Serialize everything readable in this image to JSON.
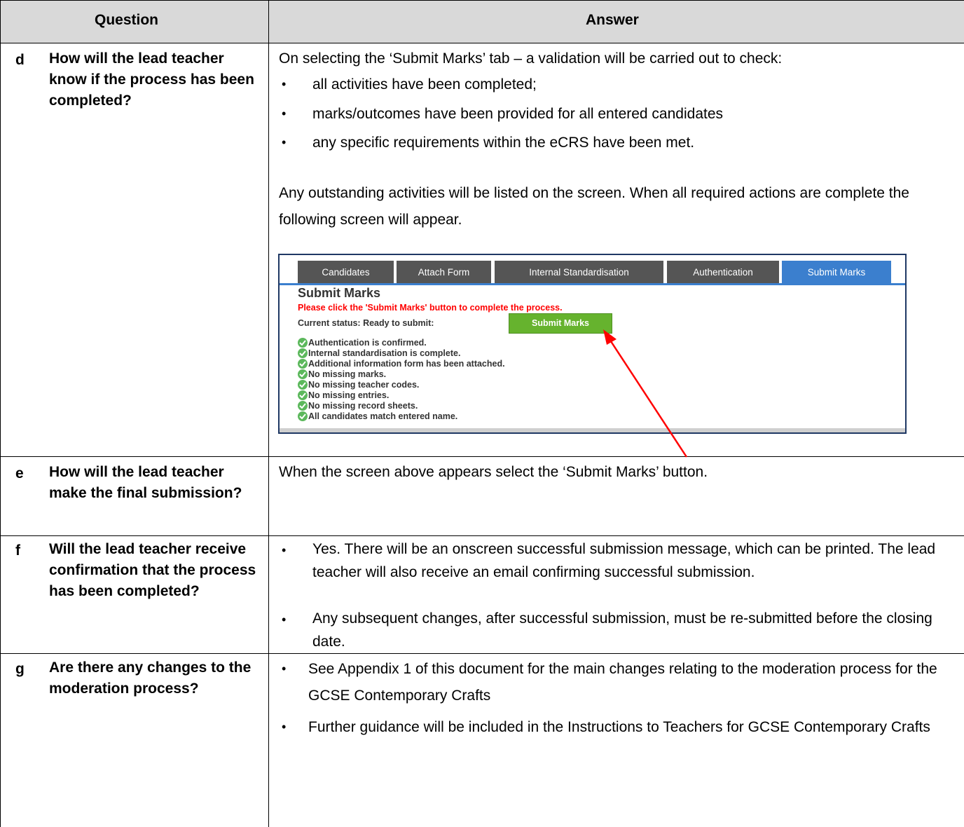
{
  "header": {
    "question": "Question",
    "answer": "Answer"
  },
  "rows": [
    {
      "letter": "d",
      "question": "How will the lead teacher know if the process has been completed?",
      "intro": "On selecting the ‘Submit Marks’ tab – a validation will be carried out to check:",
      "bullets": [
        "all activities have been completed;",
        "marks/outcomes have been provided for all entered candidates",
        "any specific requirements within the eCRS have been met."
      ],
      "para": "Any outstanding activities will be listed on the screen.  When all required actions are complete the following screen will appear."
    },
    {
      "letter": "e",
      "question": "How will the lead teacher make the final submission?",
      "answer": "When the screen above appears select the ‘Submit Marks’ button."
    },
    {
      "letter": "f",
      "question": "Will the lead teacher receive confirmation that the process has been completed?",
      "bullets": [
        "Yes.  There will be an onscreen successful submission message, which can be printed.   The lead teacher will also receive an email confirming successful submission.",
        "Any subsequent changes, after successful submission, must be re-submitted before the closing date."
      ]
    },
    {
      "letter": "g",
      "question": "Are there any changes to the moderation process?",
      "bullets": [
        "See Appendix 1 of this document for the main changes relating to the moderation process for the GCSE Contemporary Crafts",
        "Further guidance will be included in the Instructions to Teachers for GCSE Contemporary Crafts"
      ]
    }
  ],
  "screenshot": {
    "tabs": [
      "Candidates",
      "Attach Form",
      "Internal Standardisation",
      "Authentication",
      "Submit Marks"
    ],
    "active_tab": "Submit Marks",
    "title": "Submit Marks",
    "warning": "Please click the 'Submit Marks' button to complete the process.",
    "status_label": "Current status: Ready to submit:",
    "button_label": "Submit Marks",
    "checks": [
      "Authentication is confirmed.",
      "Internal standardisation is complete.",
      "Additional information form has been attached.",
      "No missing marks.",
      "No missing teacher codes.",
      "No missing entries.",
      "No missing record sheets.",
      "All candidates match entered name."
    ],
    "colors": {
      "tab": "#555555",
      "active_tab": "#3b7fce",
      "button": "#66b32e",
      "warning": "#ff0000",
      "check": "#5cb85c",
      "arrow": "#ff0000"
    }
  }
}
